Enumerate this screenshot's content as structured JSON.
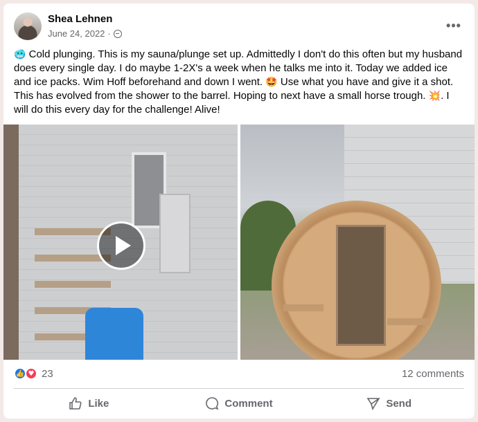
{
  "post": {
    "author": "Shea Lehnen",
    "date": "June 24, 2022",
    "dot": "·",
    "privacy_icon": "globe-icon",
    "more_label": "•••",
    "text_emoji_start": "🥶",
    "text_part1": " Cold plunging. This is my sauna/plunge set up. Admittedly I don't do this often but my husband does every single day. I do maybe 1-2X's a week when he talks me into it. Today we added ice and ice packs. Wim Hoff beforehand and down I went. ",
    "text_emoji_mid": "🤩",
    "text_part2": " Use what you have and give it a shot. This has evolved from the shower to the barrel. Hoping to next have a small horse trough. ",
    "text_emoji_end": "💥",
    "text_part3": ". I will do this every day for the challenge! Alive!"
  },
  "reactions": {
    "count": "23",
    "like_glyph": "👍",
    "love_glyph": "♥",
    "comments": "12 comments"
  },
  "actions": {
    "like": "Like",
    "comment": "Comment",
    "send": "Send"
  }
}
